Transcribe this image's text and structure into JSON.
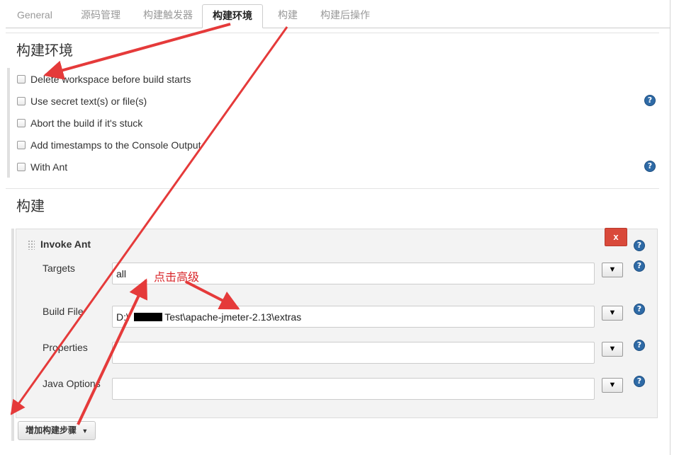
{
  "tabs": [
    "General",
    "源码管理",
    "构建触发器",
    "构建环境",
    "构建",
    "构建后操作"
  ],
  "active_tab": "构建环境",
  "build_env": {
    "title": "构建环境",
    "options": [
      {
        "label": "Delete workspace before build starts",
        "checked": false
      },
      {
        "label": "Use secret text(s) or file(s)",
        "checked": false
      },
      {
        "label": "Abort the build if it's stuck",
        "checked": false
      },
      {
        "label": "Add timestamps to the Console Output",
        "checked": false
      },
      {
        "label": "With Ant",
        "checked": false
      }
    ]
  },
  "build": {
    "title": "构建",
    "step": {
      "title": "Invoke Ant",
      "delete_label": "x",
      "fields": [
        {
          "label": "Targets",
          "value": "all"
        },
        {
          "label": "Build File",
          "value": "D:\\    \\        Test\\apache-jmeter-2.13\\extras"
        },
        {
          "label": "Properties",
          "value": ""
        },
        {
          "label": "Java Options",
          "value": ""
        }
      ],
      "dropdown_glyph": "▼"
    },
    "add_step_label": "增加构建步骤"
  },
  "help_glyph": "?",
  "annotation": {
    "text": "点击高级",
    "color": "#d8262a"
  }
}
